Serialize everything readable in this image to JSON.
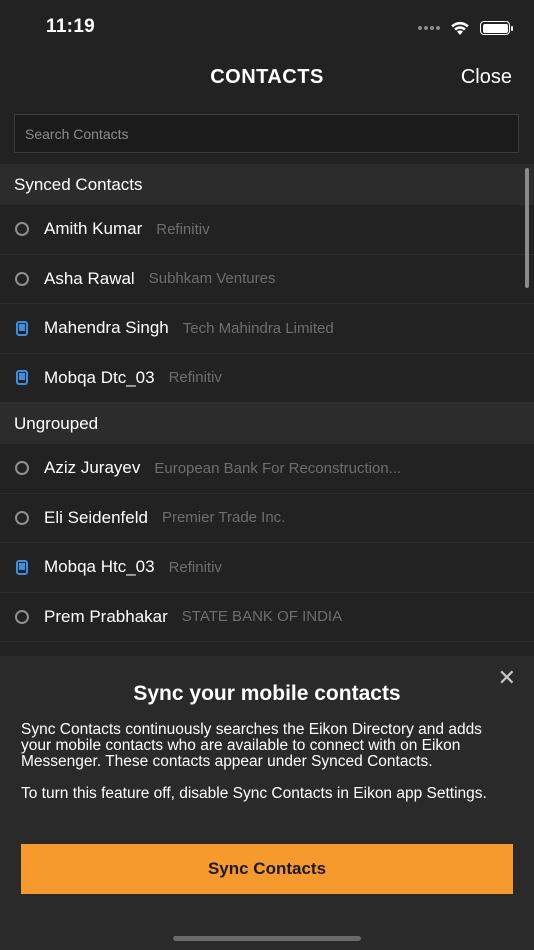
{
  "status_bar": {
    "time": "11:19"
  },
  "nav": {
    "title": "CONTACTS",
    "close_label": "Close"
  },
  "search": {
    "placeholder": "Search Contacts"
  },
  "sections": [
    {
      "title": "Synced Contacts",
      "contacts": [
        {
          "name": "Amith Kumar",
          "company": "Refinitiv",
          "icon": "presence-ring-icon"
        },
        {
          "name": "Asha Rawal",
          "company": "Subhkam Ventures",
          "icon": "presence-ring-icon"
        },
        {
          "name": "Mahendra Singh",
          "company": "Tech Mahindra Limited",
          "icon": "mobile-device-icon"
        },
        {
          "name": "Mobqa Dtc_03",
          "company": "Refinitiv",
          "icon": "mobile-device-icon"
        }
      ]
    },
    {
      "title": "Ungrouped",
      "contacts": [
        {
          "name": "Aziz Jurayev",
          "company": "European Bank For Reconstruction...",
          "icon": "presence-ring-icon"
        },
        {
          "name": "Eli Seidenfeld",
          "company": "Premier Trade Inc.",
          "icon": "presence-ring-icon"
        },
        {
          "name": "Mobqa Htc_03",
          "company": "Refinitiv",
          "icon": "mobile-device-icon"
        },
        {
          "name": "Prem Prabhakar",
          "company": "STATE BANK OF INDIA",
          "icon": "presence-ring-icon"
        }
      ]
    }
  ],
  "sync_sheet": {
    "title": "Sync your mobile contacts",
    "paragraph1": "Sync Contacts continuously searches the Eikon Directory and adds your mobile contacts who are available to connect with on Eikon Messenger. These contacts appear under Synced Contacts.",
    "paragraph2": "To turn this feature off, disable Sync Contacts in Eikon app Settings.",
    "button_label": "Sync Contacts",
    "close_glyph": "✕"
  },
  "colors": {
    "background": "#222222",
    "section_header": "#2c2c2c",
    "accent_orange": "#f79a2e",
    "mobile_icon_blue": "#3d8fe0",
    "secondary_text": "#6e6e6e"
  }
}
